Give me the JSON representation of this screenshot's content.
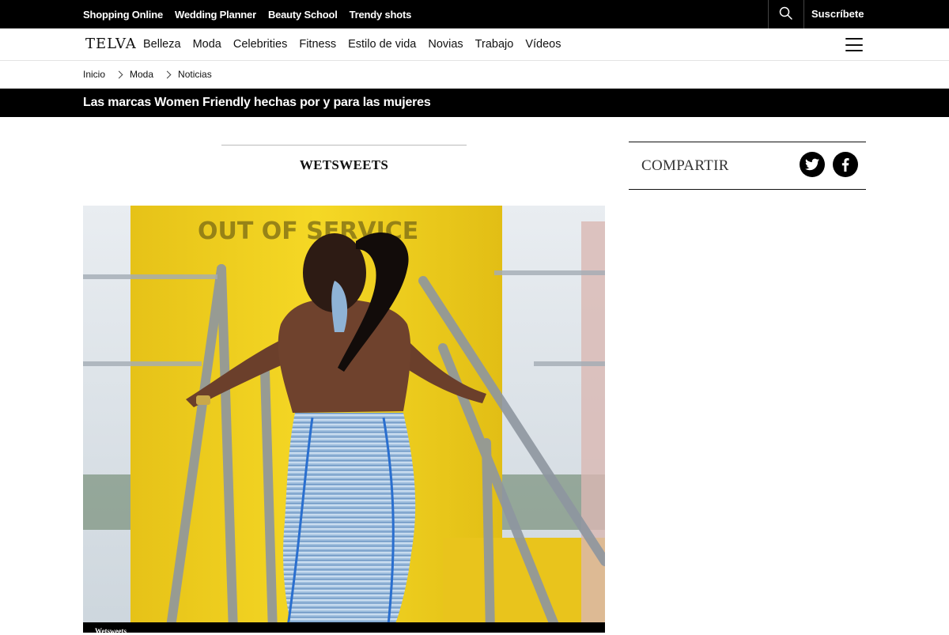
{
  "topbar": {
    "links": [
      "Shopping Online",
      "Wedding Planner",
      "Beauty School",
      "Trendy shots"
    ],
    "search_icon": "search-icon",
    "subscribe_label": "Suscríbete"
  },
  "nav": {
    "logo": "TELVA",
    "items": [
      "Belleza",
      "Moda",
      "Celebrities",
      "Fitness",
      "Estilo de vida",
      "Novias",
      "Trabajo",
      "Vídeos"
    ],
    "menu_icon": "hamburger-menu-icon"
  },
  "breadcrumb": [
    "Inicio",
    "Moda",
    "Noticias"
  ],
  "article": {
    "title": "Las marcas Women Friendly hechas por y para las mujeres",
    "brand": "WETSWEETS",
    "photo_caption": "Wetsweets",
    "photo_sign_text": "OUT OF SERVICE"
  },
  "share": {
    "label": "COMPARTIR",
    "buttons": [
      "twitter-icon",
      "facebook-icon"
    ]
  },
  "colors": {
    "header_bg": "#000000",
    "sign_yellow": "#f2d31a",
    "outfit_blue": "#8fb3d6"
  }
}
